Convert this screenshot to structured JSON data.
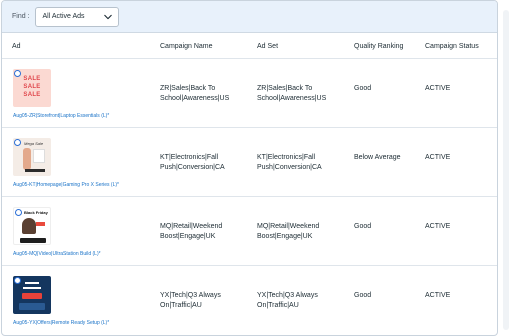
{
  "filter": {
    "label": "Find :",
    "selected": "All Active Ads"
  },
  "columns": [
    "Ad",
    "Campaign Name",
    "Ad Set",
    "Quality Ranking",
    "Campaign Status"
  ],
  "rows": [
    {
      "ad_name": "Aug05-ZR|Storefront|Laptop Essentials (L)*",
      "campaign": "ZR|Sales|Back To School|Awareness|US",
      "ad_set": "ZR|Sales|Back To School|Awareness|US",
      "quality": "Good",
      "status": "ACTIVE",
      "thumb_text": [
        "SALE",
        "SALE",
        "SALE"
      ]
    },
    {
      "ad_name": "Aug05-KT|Homepage|Gaming Pro X Series (L)*",
      "campaign": "KT|Electronics|Fall Push|Conversion|CA",
      "ad_set": "KT|Electronics|Fall Push|Conversion|CA",
      "quality": "Below Average",
      "status": "ACTIVE",
      "thumb_text": [
        "Mega Sale"
      ]
    },
    {
      "ad_name": "Aug05-MQ|Video|UltraStation Build (L)*",
      "campaign": "MQ|Retail|Weekend Boost|Engage|UK",
      "ad_set": "MQ|Retail|Weekend Boost|Engage|UK",
      "quality": "Good",
      "status": "ACTIVE",
      "thumb_text": [
        "Black Friday"
      ]
    },
    {
      "ad_name": "Aug05-YX|Offers|Remote Ready Setup (L)*",
      "campaign": "YX|Tech|Q3 Always On|Traffic|AU",
      "ad_set": "YX|Tech|Q3 Always On|Traffic|AU",
      "quality": "Good",
      "status": "ACTIVE",
      "thumb_text": []
    }
  ],
  "colors": {
    "header_bg": "#e8f1fb",
    "link": "#1a73c8",
    "border": "#dfe5eb"
  }
}
